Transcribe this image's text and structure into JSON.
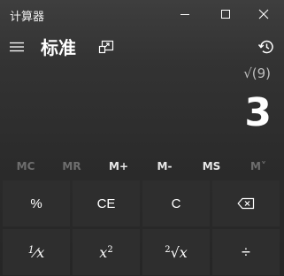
{
  "window": {
    "title": "计算器"
  },
  "header": {
    "mode_title": "标准",
    "icons": {
      "menu": "hamburger-menu-icon",
      "keep_on_top": "keep-on-top-icon",
      "history": "history-icon"
    }
  },
  "display": {
    "expression": "√(9)",
    "result": "3"
  },
  "memory": {
    "buttons": [
      {
        "label": "MC",
        "enabled": false
      },
      {
        "label": "MR",
        "enabled": false
      },
      {
        "label": "M+",
        "enabled": true
      },
      {
        "label": "M-",
        "enabled": true
      },
      {
        "label": "MS",
        "enabled": true
      },
      {
        "label": "M˅",
        "enabled": false
      }
    ]
  },
  "keypad": {
    "row1": {
      "percent": "%",
      "clear_entry": "CE",
      "clear": "C",
      "backspace": "backspace-icon"
    },
    "row2": {
      "reciprocal_num": "1",
      "reciprocal_den": "x",
      "square_base": "x",
      "square_exp": "2",
      "sqrt_index": "2",
      "sqrt_radicand": "x",
      "divide": "÷"
    }
  },
  "colors": {
    "background": "#2b2b2b",
    "key": "#323232",
    "disabled_text": "#6e6e6e"
  }
}
